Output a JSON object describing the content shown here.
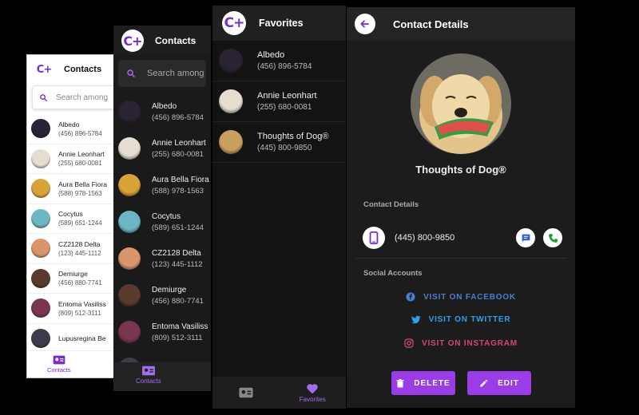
{
  "logo_text": "C+",
  "contacts_title": "Contacts",
  "search_placeholder": "Search among",
  "contacts": [
    {
      "name": "Albedo",
      "phone": "(456) 896-5784",
      "avatar_color": "#2b2233"
    },
    {
      "name": "Annie Leonhart",
      "phone": "(255) 680-0081",
      "avatar_color": "#e6ddd2"
    },
    {
      "name": "Aura Bella Fiora",
      "phone": "(588) 978-1563",
      "avatar_color": "#d8a43a"
    },
    {
      "name": "Cocytus",
      "phone": "(589) 651-1244",
      "avatar_color": "#6fb6c4"
    },
    {
      "name": "CZ2128 Delta",
      "phone": "(123) 445-1112",
      "avatar_color": "#d9956b"
    },
    {
      "name": "Demiurge",
      "phone": "(456) 880-7741",
      "avatar_color": "#5a3a2e"
    },
    {
      "name": "Entoma Vasiliss",
      "phone": "(809) 512-3111",
      "avatar_color": "#7a3550"
    },
    {
      "name": "Lupusregina Be",
      "phone": "",
      "avatar_color": "#3c3c4c"
    }
  ],
  "nav_contacts_label": "Contacts",
  "nav_favorites_label": "Favorites",
  "favorites_title": "Favorites",
  "favorites": [
    {
      "name": "Albedo",
      "phone": "(456) 896-5784",
      "avatar_color": "#2b2233"
    },
    {
      "name": "Annie Leonhart",
      "phone": "(255) 680-0081",
      "avatar_color": "#e6ddd2"
    },
    {
      "name": "Thoughts of Dog®",
      "phone": "(445) 800-9850",
      "avatar_color": "#c9a060"
    }
  ],
  "details": {
    "title": "Contact Details",
    "name": "Thoughts of Dog®",
    "section_contact": "Contact Details",
    "phone": "(445) 800-9850",
    "section_social": "Social Accounts",
    "facebook_label": "VISIT ON FACEBOOK",
    "twitter_label": "VISIT ON TWITTER",
    "instagram_label": "VISIT ON INSTAGRAM",
    "delete_label": "DELETE",
    "edit_label": "EDIT"
  },
  "colors": {
    "accent": "#9a3de6",
    "facebook": "#4a7fd6",
    "twitter": "#2f9fe8",
    "instagram": "#d6457a",
    "call_green": "#1a9e3a"
  }
}
